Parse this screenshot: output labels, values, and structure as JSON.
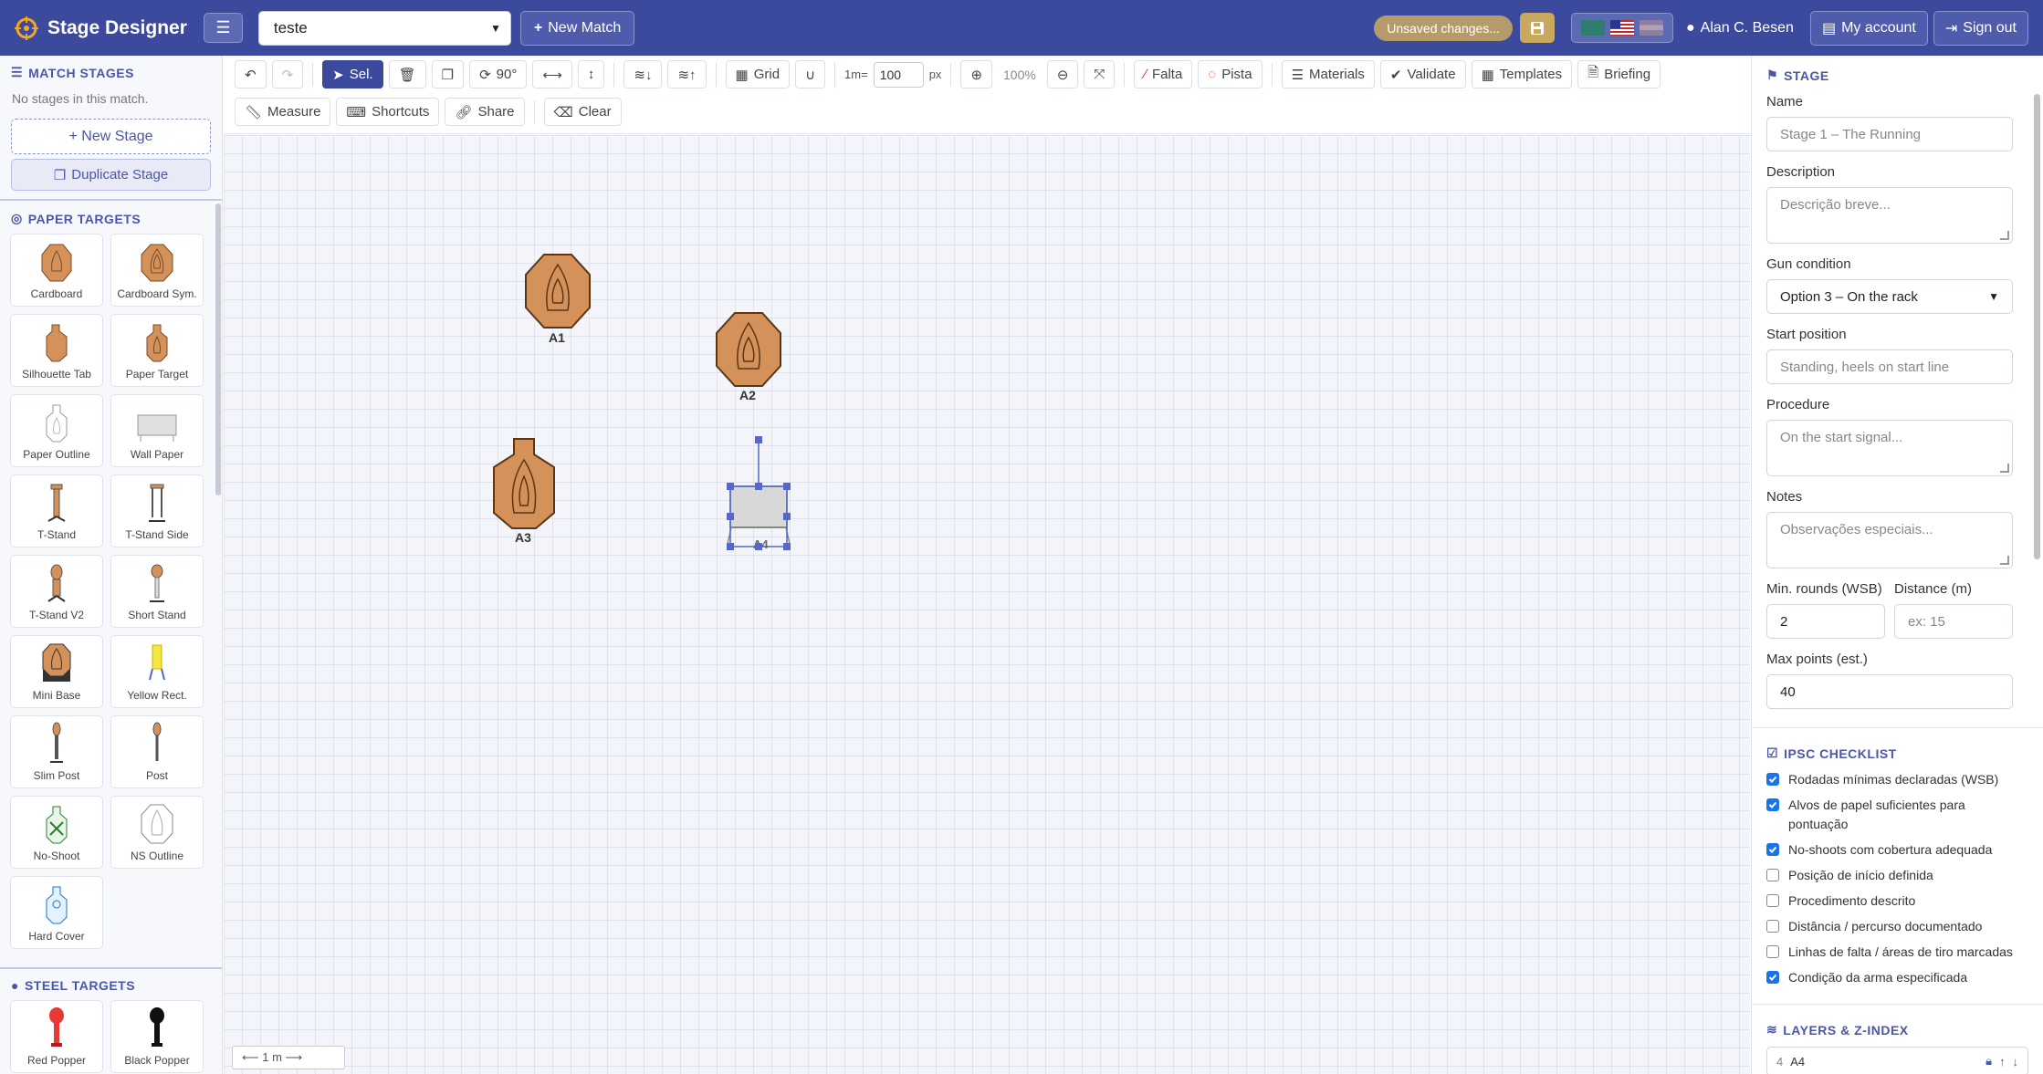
{
  "header": {
    "brand": "Stage Designer",
    "match_select": "teste",
    "new_match": "New Match",
    "unsaved": "Unsaved changes...",
    "user_name": "Alan C. Besen",
    "my_account": "My account",
    "sign_out": "Sign out",
    "colors": {
      "bar": "#3c4a9e",
      "accent": "#4a57a8"
    }
  },
  "left": {
    "match_stages_title": "MATCH STAGES",
    "no_stages": "No stages in this match.",
    "new_stage": "+ New Stage",
    "duplicate_stage": "Duplicate Stage",
    "paper_title": "PAPER TARGETS",
    "paper_targets": [
      {
        "label": "Cardboard",
        "icon": "cardboard-icon"
      },
      {
        "label": "Cardboard Sym.",
        "icon": "cardboard-sym-icon"
      },
      {
        "label": "Silhouette Tab",
        "icon": "silhouette-tab-icon"
      },
      {
        "label": "Paper Target",
        "icon": "paper-target-icon"
      },
      {
        "label": "Paper Outline",
        "icon": "paper-outline-icon"
      },
      {
        "label": "Wall Paper",
        "icon": "wall-paper-icon"
      },
      {
        "label": "T-Stand",
        "icon": "t-stand-icon"
      },
      {
        "label": "T-Stand Side",
        "icon": "t-stand-side-icon"
      },
      {
        "label": "T-Stand V2",
        "icon": "t-stand-v2-icon"
      },
      {
        "label": "Short Stand",
        "icon": "short-stand-icon"
      },
      {
        "label": "Mini Base",
        "icon": "mini-base-icon"
      },
      {
        "label": "Yellow Rect.",
        "icon": "yellow-rect-icon"
      },
      {
        "label": "Slim Post",
        "icon": "slim-post-icon"
      },
      {
        "label": "Post",
        "icon": "post-icon"
      },
      {
        "label": "No-Shoot",
        "icon": "no-shoot-icon"
      },
      {
        "label": "NS Outline",
        "icon": "ns-outline-icon"
      },
      {
        "label": "Hard Cover",
        "icon": "hard-cover-icon"
      }
    ],
    "steel_title": "STEEL TARGETS",
    "steel_targets": [
      {
        "label": "Red Popper",
        "icon": "red-popper-icon"
      },
      {
        "label": "Black Popper",
        "icon": "black-popper-icon"
      }
    ]
  },
  "toolbar": {
    "select": "Sel.",
    "rotate": "90°",
    "grid": "Grid",
    "scale_prefix": "1m=",
    "scale_value": "100",
    "scale_unit": "px",
    "zoom": "100%",
    "falta": "Falta",
    "pista": "Pista",
    "materials": "Materials",
    "validate": "Validate",
    "templates": "Templates",
    "briefing": "Briefing",
    "measure": "Measure",
    "shortcuts": "Shortcuts",
    "share": "Share",
    "clear": "Clear"
  },
  "canvas": {
    "targets": [
      "A1",
      "A2",
      "A3",
      "A4"
    ],
    "scale_label": "⟵ 1 m ⟶"
  },
  "stage": {
    "title": "STAGE",
    "name_label": "Name",
    "name_placeholder": "Stage 1 – The Running",
    "description_label": "Description",
    "description_placeholder": "Descrição breve...",
    "gun_condition_label": "Gun condition",
    "gun_condition_value": "Option 3 – On the rack",
    "start_position_label": "Start position",
    "start_position_placeholder": "Standing, heels on start line",
    "procedure_label": "Procedure",
    "procedure_placeholder": "On the start signal...",
    "notes_label": "Notes",
    "notes_placeholder": "Observações especiais...",
    "min_rounds_label": "Min. rounds (WSB)",
    "min_rounds_value": "2",
    "distance_label": "Distance (m)",
    "distance_placeholder": "ex: 15",
    "max_points_label": "Max points (est.)",
    "max_points_value": "40"
  },
  "checklist": {
    "title": "IPSC CHECKLIST",
    "items": [
      {
        "label": "Rodadas mínimas declaradas (WSB)",
        "checked": true
      },
      {
        "label": "Alvos de papel suficientes para pontuação",
        "checked": true
      },
      {
        "label": "No-shoots com cobertura adequada",
        "checked": true
      },
      {
        "label": "Posição de início definida",
        "checked": false
      },
      {
        "label": "Procedimento descrito",
        "checked": false
      },
      {
        "label": "Distância / percurso documentado",
        "checked": false
      },
      {
        "label": "Linhas de falta / áreas de tiro marcadas",
        "checked": false
      },
      {
        "label": "Condição da arma especificada",
        "checked": true
      }
    ]
  },
  "layers": {
    "title": "LAYERS & Z-INDEX",
    "first_item": "A4"
  }
}
